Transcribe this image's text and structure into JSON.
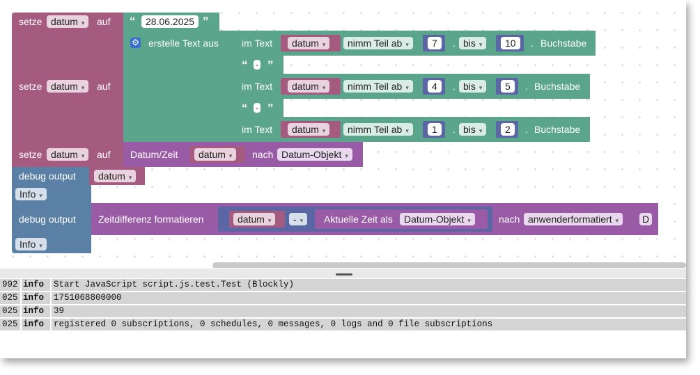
{
  "blocks": {
    "block1": {
      "set_label": "setze",
      "var": "datum",
      "to_label": "auf",
      "value": "28.06.2025"
    },
    "block2": {
      "set_label": "setze",
      "var": "datum",
      "to_label": "auf",
      "join_label": "erstelle Text aus",
      "rows": [
        {
          "in_text_label": "im Text",
          "var": "datum",
          "mode": "nimm Teil ab",
          "from": "7",
          "to_label": "bis",
          "to": "10",
          "suffix": "Buchstabe"
        },
        {
          "string": "-"
        },
        {
          "in_text_label": "im Text",
          "var": "datum",
          "mode": "nimm Teil ab",
          "from": "4",
          "to_label": "bis",
          "to": "5",
          "suffix": "Buchstabe"
        },
        {
          "string": "-"
        },
        {
          "in_text_label": "im Text",
          "var": "datum",
          "mode": "nimm Teil ab",
          "from": "1",
          "to_label": "bis",
          "to": "2",
          "suffix": "Buchstabe"
        }
      ]
    },
    "block3": {
      "set_label": "setze",
      "var": "datum",
      "to_label": "auf",
      "convert_label": "Datum/Zeit",
      "var2": "datum",
      "to_word": "nach",
      "format": "Datum-Objekt"
    },
    "block4": {
      "label": "debug output",
      "var": "datum",
      "level": "Info"
    },
    "block5": {
      "label": "debug output",
      "diff_label": "Zeitdifferenz formatieren",
      "var": "datum",
      "op": "-",
      "now_label": "Aktuelle Zeit als",
      "now_format": "Datum-Objekt",
      "to_word": "nach",
      "format": "anwenderformatiert",
      "extra": "D",
      "level": "Info"
    }
  },
  "log": [
    {
      "time": "992",
      "level": "info",
      "message": "Start JavaScript script.js.test.Test (Blockly)"
    },
    {
      "time": "025",
      "level": "info",
      "message": "1751068800000"
    },
    {
      "time": "025",
      "level": "info",
      "message": "39"
    },
    {
      "time": "025",
      "level": "info",
      "message": "registered 0 subscriptions, 0 schedules, 0 messages, 0 logs and 0 file subscriptions"
    }
  ],
  "colors": {
    "variables": "#a55b80",
    "text": "#5ba58c",
    "time": "#995ba5",
    "debug": "#5b80a5",
    "math": "#5b67a5"
  }
}
